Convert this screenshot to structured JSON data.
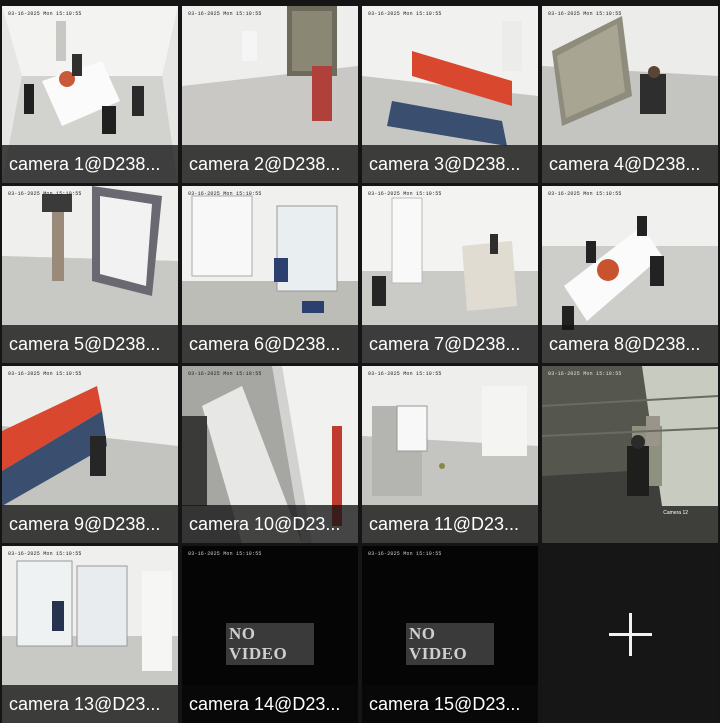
{
  "cameras": [
    {
      "label": "camera 1@D238...",
      "timestamp": "03-16-2025 Mon 15:10:55"
    },
    {
      "label": "camera 2@D238...",
      "timestamp": "03-16-2025 Mon 15:10:55"
    },
    {
      "label": "camera 3@D238...",
      "timestamp": "03-16-2025 Mon 15:10:55"
    },
    {
      "label": "camera 4@D238...",
      "timestamp": "03-16-2025 Mon 15:10:55"
    },
    {
      "label": "camera 5@D238...",
      "timestamp": "03-16-2025 Mon 15:10:55"
    },
    {
      "label": "camera 6@D238...",
      "timestamp": "03-16-2025 Mon 15:10:55"
    },
    {
      "label": "camera 7@D238...",
      "timestamp": "03-16-2025 Mon 15:10:55"
    },
    {
      "label": "camera 8@D238...",
      "timestamp": "03-16-2025 Mon 15:10:55"
    },
    {
      "label": "camera 9@D238...",
      "timestamp": "03-16-2025 Mon 15:10:55"
    },
    {
      "label": "camera 10@D23...",
      "timestamp": "03-16-2025 Mon 15:10:55"
    },
    {
      "label": "camera 11@D23...",
      "timestamp": "03-16-2025 Mon 15:10:55"
    },
    {
      "label": "",
      "timestamp": "03-16-2025 Mon 15:10:55",
      "selected": true,
      "overlay": "Camera 12"
    },
    {
      "label": "camera 13@D23...",
      "timestamp": "03-16-2025 Mon 15:10:55"
    },
    {
      "label": "camera 14@D23...",
      "timestamp": "03-16-2025 Mon 15:10:55",
      "status": "NO VIDEO"
    },
    {
      "label": "camera 15@D23...",
      "timestamp": "03-16-2025 Mon 15:10:55",
      "status": "NO VIDEO"
    }
  ],
  "add_tile": {
    "icon": "plus-icon"
  },
  "colors": {
    "selected_border": "#e05050",
    "label_bar": "#141414",
    "accent_wall": "#d9472f"
  }
}
